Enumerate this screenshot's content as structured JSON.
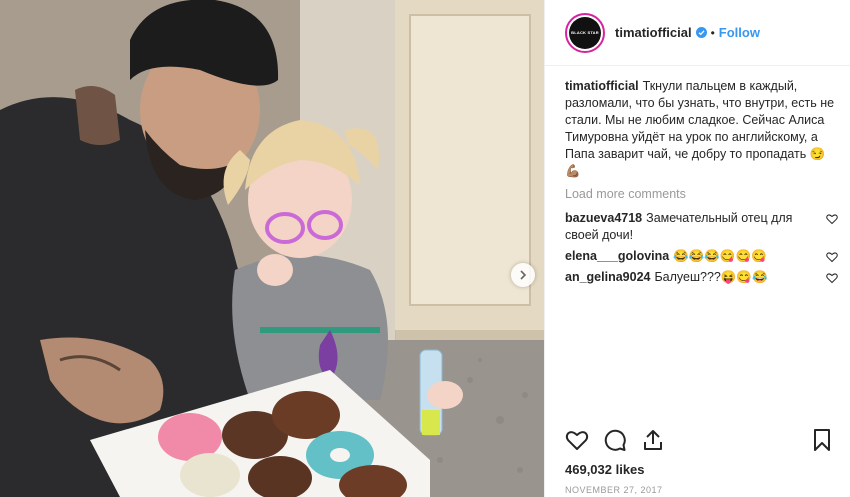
{
  "post": {
    "username": "timatiofficial",
    "avatar_label": "BLACK STAR",
    "follow_label": "Follow",
    "separator": "•",
    "caption_text": "Ткнули пальцем в каждый, разломали, что бы узнать, что внутри, есть не стали. Мы не любим сладкое. Сейчас Алиса Тимуровна уйдёт на урок по английскому, а Папа заварит чай, че добру то пропадать 😏💪🏽",
    "load_more": "Load more comments",
    "comments": [
      {
        "user": "bazueva4718",
        "text": "Замечательный отец для своей дочи!"
      },
      {
        "user": "elena___golovina",
        "text": "😂😂😂😋😋😋"
      },
      {
        "user": "an_gelina9024",
        "text": "Балуеш???😝😋😂"
      }
    ],
    "likes": "469,032 likes",
    "date": "NOVEMBER 27, 2017"
  },
  "colors": {
    "link": "#3897f0",
    "text": "#262626",
    "muted": "#999999",
    "verified": "#3897f0"
  },
  "icons": [
    "heart-icon",
    "comment-icon",
    "share-icon",
    "bookmark-icon",
    "verified-badge-icon",
    "chevron-right-icon"
  ]
}
